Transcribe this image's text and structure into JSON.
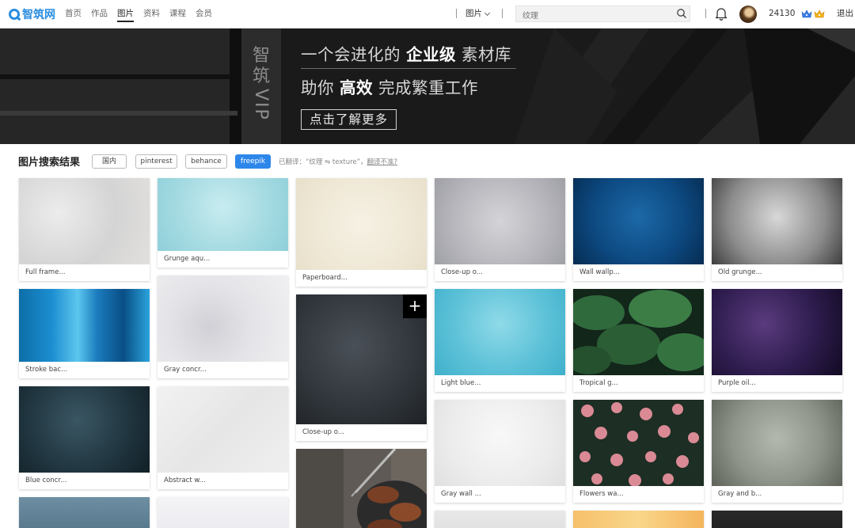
{
  "header": {
    "logo_text": "智筑网",
    "nav": [
      "首页",
      "作品",
      "图片",
      "资料",
      "课程",
      "会员"
    ],
    "active_nav": "图片",
    "category_select": "图片",
    "search_placeholder": "纹理",
    "points": "24130",
    "logout_label": "退出",
    "icons": [
      "search-icon",
      "bell-icon",
      "crown-icon"
    ]
  },
  "banner": {
    "vip_chars": [
      "智",
      "筑"
    ],
    "vip_tag": "VIP",
    "slogan1_pre": "一个会进化的 ",
    "slogan1_bold": "企业级",
    "slogan1_post": " 素材库",
    "slogan2_pre": "助你 ",
    "slogan2_bold": "高效",
    "slogan2_post": " 完成繁重工作",
    "button_label": "点击了解更多"
  },
  "results": {
    "title": "图片搜索结果",
    "sources": [
      "国内",
      "pinterest",
      "behance",
      "freepik"
    ],
    "active_source": "freepik",
    "translate_text": "已翻译：“纹理 ⇋ texture”，",
    "translate_link": "翻译不准?"
  },
  "cards": [
    {
      "caption": "Full frame..."
    },
    {
      "caption": "Stroke bac..."
    },
    {
      "caption": "Blue concr..."
    },
    {
      "caption": ""
    },
    {
      "caption": "Grunge aqu..."
    },
    {
      "caption": "Gray concr..."
    },
    {
      "caption": "Abstract w..."
    },
    {
      "caption": ""
    },
    {
      "caption": "Paperboard..."
    },
    {
      "caption": "Close-up o...",
      "plus": "+"
    },
    {
      "caption": ""
    },
    {
      "caption": "Close-up o..."
    },
    {
      "caption": "Light blue..."
    },
    {
      "caption": "Gray wall ..."
    },
    {
      "caption": ""
    },
    {
      "caption": "Wall wallp..."
    },
    {
      "caption": "Tropical g..."
    },
    {
      "caption": "Flowers wa..."
    },
    {
      "caption": ""
    },
    {
      "caption": "Old grunge..."
    },
    {
      "caption": "Purple oil..."
    },
    {
      "caption": "Gray and b..."
    },
    {
      "caption": ""
    }
  ],
  "colors": {
    "accent": "#2d87ea",
    "logo_blue": "#2a8de0",
    "banner_bg": "#1c1c1c"
  }
}
